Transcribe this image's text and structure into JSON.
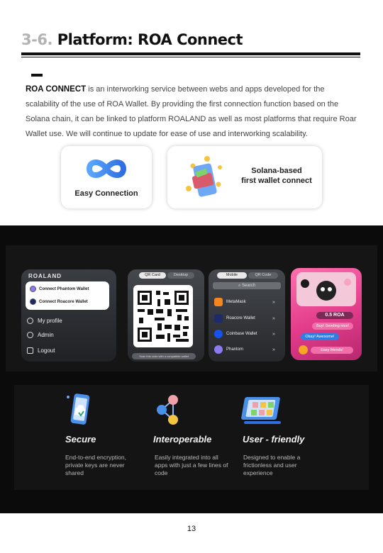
{
  "header": {
    "section_number": "3-6.",
    "section_title": "Platform: ROA Connect"
  },
  "intro": {
    "lead": "ROA CONNECT",
    "body": " is an interworking service between webs and apps developed for the scalability of the use of ROA Wallet. By providing the first connection function based on the Solana chain, it can be linked to platform ROALAND as well as most platforms that require Roar Wallet use. We will continue to update for ease of use and interworking scalability."
  },
  "cards": {
    "easy": "Easy Connection",
    "solana_line1": "Solana-based",
    "solana_line2": "first wallet connect"
  },
  "mockups": {
    "brand": "ROALAND",
    "connect_phantom": "Connect Phantom Wallet",
    "connect_roacore": "Connect Roacore Wallet",
    "menu": [
      "My profile",
      "Admin",
      "Logout"
    ],
    "qr_tab_active": "QR Card",
    "qr_tab_inactive": "Desktop",
    "qr_caption": "Scan this code with a compatible wallet",
    "mobile_tab_active": "Mobile",
    "mobile_tab_inactive": "QR Code",
    "search": "Search",
    "wallets": [
      {
        "name": "MetaMask",
        "color": "#f6851b"
      },
      {
        "name": "Roacore Wallet",
        "color": "#1d2b6b"
      },
      {
        "name": "Coinbase Wallet",
        "color": "#1652f0"
      },
      {
        "name": "Phantom",
        "color": "#8a7cf0"
      }
    ],
    "chat_amount": "0.5 ROA",
    "chat_msg1": "Buy! Sending nice!",
    "chat_msg2": "Okay! Awesome!",
    "chat_msg3": "Easy friends!"
  },
  "features": [
    {
      "title": "Secure",
      "desc": "End-to-end encryption, private keys are never shared"
    },
    {
      "title": "Interoperable",
      "desc": "Easily integrated into all apps with just a few lines of code"
    },
    {
      "title": "User - friendly",
      "desc": "Designed to enable a frictionless and user experience"
    }
  ],
  "page_number": "13",
  "colors": {
    "accent_blue": "#2f7de1",
    "accent_pink": "#e23c8a"
  }
}
